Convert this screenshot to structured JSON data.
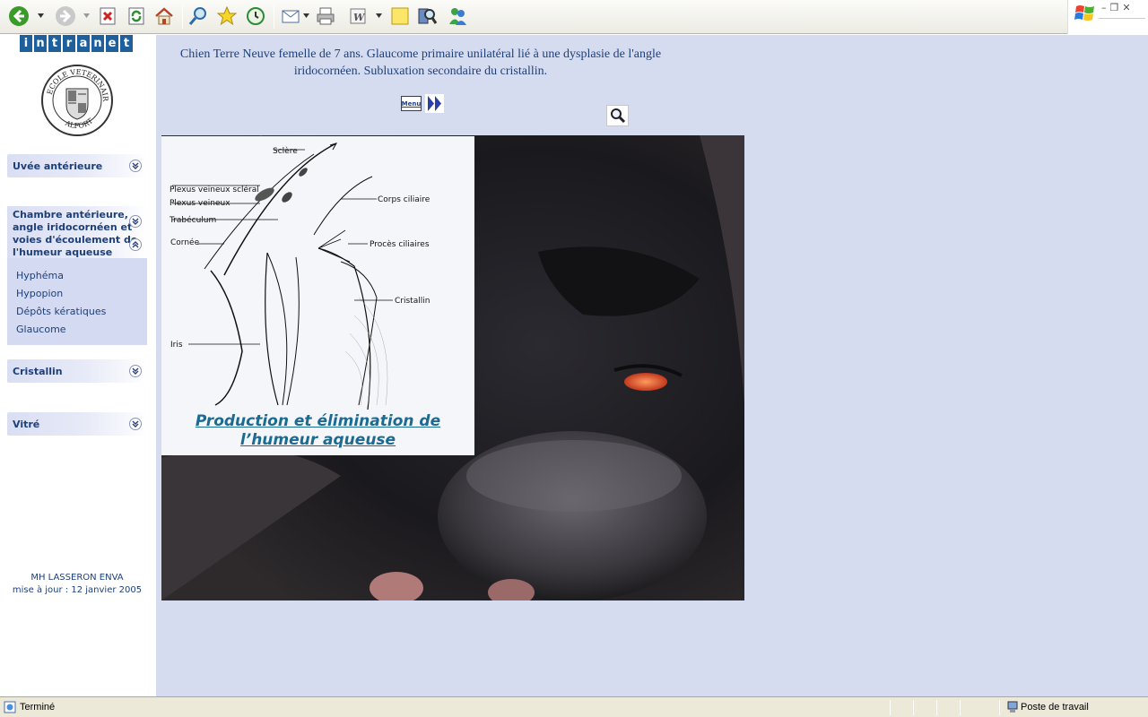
{
  "toolbar": {
    "buttons": [
      "back-icon",
      "forward-icon",
      "stop-icon",
      "refresh-icon",
      "home-icon",
      "search-icon",
      "favorites-icon",
      "history-icon",
      "mail-icon",
      "print-icon",
      "edit-icon",
      "discuss-icon",
      "research-icon",
      "messenger-icon"
    ]
  },
  "sidebar": {
    "logo_letters": [
      "i",
      "n",
      "t",
      "r",
      "a",
      "n",
      "e",
      "t"
    ],
    "seal_alt_text": "ECOLE VETERINAIRE ALFORT",
    "nav": [
      {
        "label": "Uvée antérieure"
      },
      {
        "label": "Chambre antérieure, angle iridocornéen et voies d'écoulement de l'humeur aqueuse"
      },
      {
        "label": "Cristallin"
      },
      {
        "label": "Vitré"
      }
    ],
    "submenu": [
      "Hyphéma",
      "Hypopion",
      "Dépôts kératiques",
      "Glaucome"
    ],
    "credit_line1": "MH LASSERON ENVA",
    "credit_line2": "mise à jour : 12 janvier 2005"
  },
  "main": {
    "caption": "Chien Terre Neuve femelle de 7 ans. Glaucome primaire unilatéral lié à une dysplasie de l'angle iridocornéen. Subluxation secondaire du cristallin.",
    "menu_label": "Menu",
    "diagram": {
      "labels": {
        "sclere": "Sclère",
        "plexus_scleral": "Plexus veineux scléral",
        "plexus": "Plexus veineux",
        "trabeculum": "Trabéculum",
        "cornee": "Cornée",
        "corps_ciliaire": "Corps ciliaire",
        "proces": "Procès ciliaires",
        "cristallin": "Cristallin",
        "iris": "Iris"
      },
      "title": "Production et élimination de l’humeur aqueuse"
    }
  },
  "statusbar": {
    "status": "Terminé",
    "zone": "Poste de travail"
  },
  "colors": {
    "content_bg": "#d6dcf0",
    "nav_text": "#1d3f7a",
    "intranet_blue": "#1f5f9c",
    "diagram_title": "#1b6a92"
  }
}
